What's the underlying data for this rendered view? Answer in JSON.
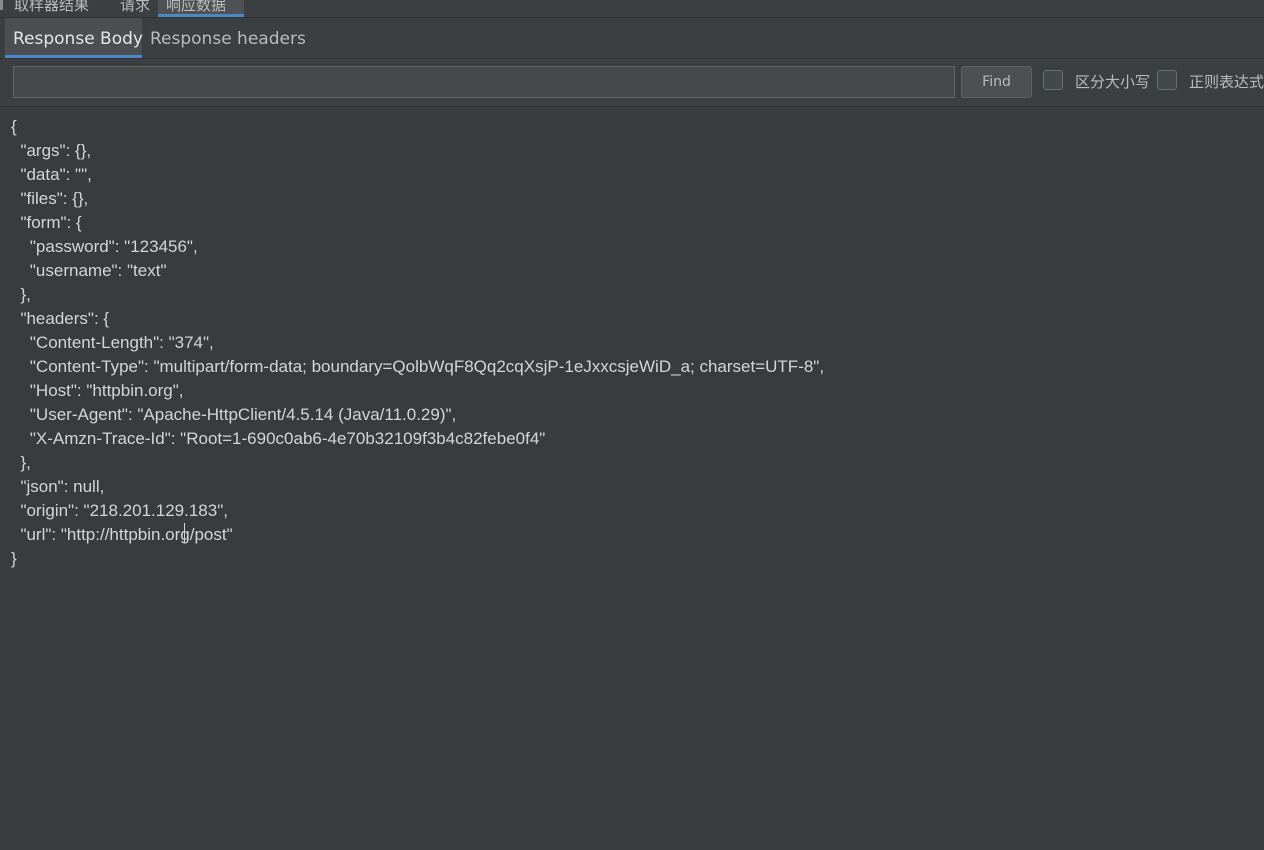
{
  "top_tabs": [
    {
      "label": "取样器结果"
    },
    {
      "label": "请求"
    },
    {
      "label": "响应数据"
    }
  ],
  "sub_tabs": {
    "body": "Response Body",
    "headers": "Response headers"
  },
  "search": {
    "value": "",
    "find_label": "Find",
    "case_sensitive_label": "区分大小写",
    "regex_label": "正则表达式"
  },
  "response_lines": [
    "{",
    "  \"args\": {},",
    "  \"data\": \"\",",
    "  \"files\": {},",
    "  \"form\": {",
    "    \"password\": \"123456\",",
    "    \"username\": \"text\"",
    "  },",
    "  \"headers\": {",
    "    \"Content-Length\": \"374\",",
    "    \"Content-Type\": \"multipart/form-data; boundary=QolbWqF8Qq2cqXsjP-1eJxxcsjeWiD_a; charset=UTF-8\",",
    "    \"Host\": \"httpbin.org\",",
    "    \"User-Agent\": \"Apache-HttpClient/4.5.14 (Java/11.0.29)\",",
    "    \"X-Amzn-Trace-Id\": \"Root=1-690c0ab6-4e70b32109f3b4c82febe0f4\"",
    "  },",
    "  \"json\": null,",
    "  \"origin\": \"218.201.129.183\",",
    "  \"url\": \"http://httpbin.org/post\"",
    "}"
  ],
  "colors": {
    "background": "#3c3f41",
    "accent": "#4a88c7",
    "text": "#bbbbbb"
  }
}
